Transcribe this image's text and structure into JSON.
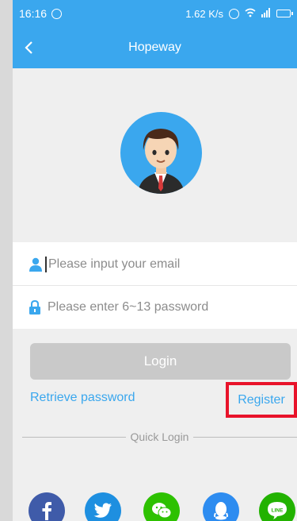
{
  "status_bar": {
    "time": "16:16",
    "network_speed": "1.62 K/s"
  },
  "header": {
    "title": "Hopeway"
  },
  "form": {
    "email_placeholder": "Please input your email",
    "password_placeholder": "Please enter 6~13 password",
    "login_label": "Login"
  },
  "links": {
    "retrieve_password": "Retrieve password",
    "register": "Register"
  },
  "quick_login": {
    "label": "Quick Login",
    "providers": [
      "facebook",
      "twitter",
      "wechat",
      "qq",
      "line"
    ]
  },
  "colors": {
    "primary": "#3aa7ee",
    "background": "#efefef",
    "login_disabled": "#c9c9c9",
    "highlight_box": "#e8132a",
    "facebook": "#3f5ba9",
    "twitter": "#1e8fe0",
    "wechat": "#2dc100",
    "qq": "#2d8cf0",
    "line": "#22b200"
  }
}
